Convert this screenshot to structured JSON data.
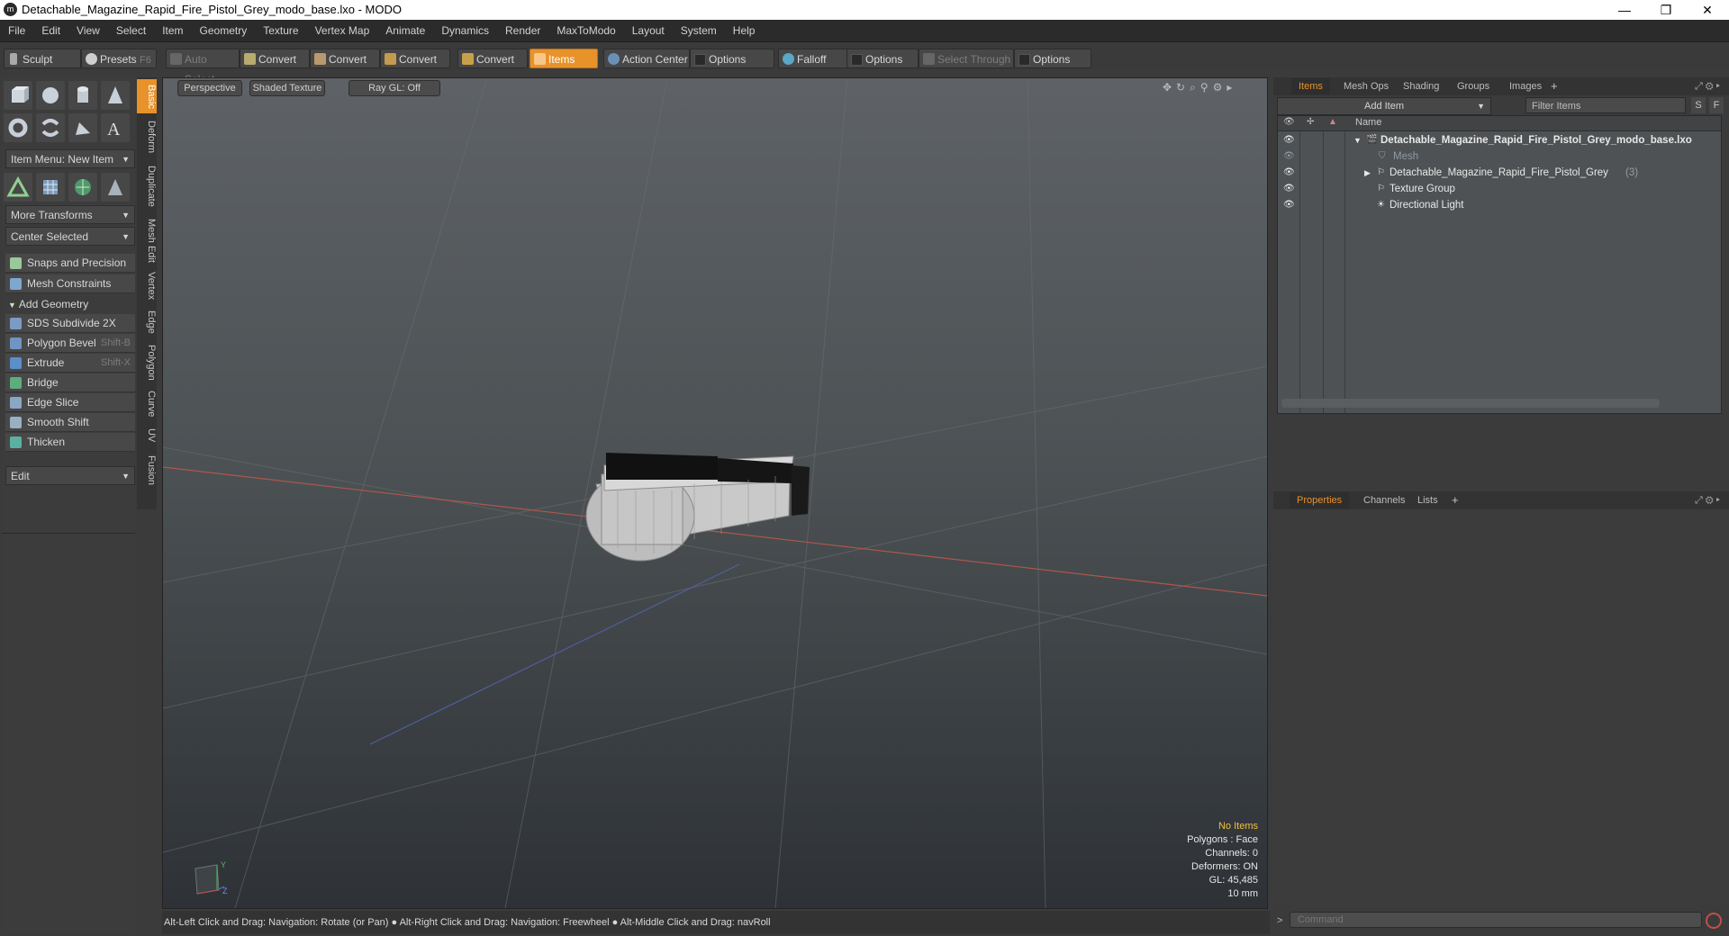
{
  "window": {
    "title": "Detachable_Magazine_Rapid_Fire_Pistol_Grey_modo_base.lxo - MODO",
    "logo": "modo-logo-icon"
  },
  "menu": [
    "File",
    "Edit",
    "View",
    "Select",
    "Item",
    "Geometry",
    "Texture",
    "Vertex Map",
    "Animate",
    "Dynamics",
    "Render",
    "MaxToModo",
    "Layout",
    "System",
    "Help"
  ],
  "toolbar": {
    "sculpt": "Sculpt",
    "presets": "Presets",
    "presets_key": "F6",
    "auto_select": "Auto Select",
    "convert": "Convert",
    "items": "Items",
    "action_center": "Action Center",
    "options": "Options",
    "falloff": "Falloff",
    "select_through": "Select Through"
  },
  "left": {
    "item_menu": "Item Menu: New Item",
    "more_transforms": "More Transforms",
    "center_selected": "Center Selected",
    "snaps": "Snaps and Precision",
    "mesh_constraints": "Mesh Constraints",
    "add_geometry": "Add Geometry",
    "tools": [
      {
        "label": "SDS Subdivide 2X",
        "key": ""
      },
      {
        "label": "Polygon Bevel",
        "key": "Shift-B"
      },
      {
        "label": "Extrude",
        "key": "Shift-X"
      },
      {
        "label": "Bridge",
        "key": ""
      },
      {
        "label": "Edge Slice",
        "key": ""
      },
      {
        "label": "Smooth Shift",
        "key": ""
      },
      {
        "label": "Thicken",
        "key": ""
      }
    ],
    "edit": "Edit",
    "vtabs": [
      "Basic",
      "Deform",
      "Duplicate",
      "Mesh Edit",
      "Vertex",
      "Edge",
      "Polygon",
      "Curve",
      "UV",
      "Fusion"
    ]
  },
  "viewport": {
    "view": "Perspective",
    "shading": "Shaded Texture",
    "raygl": "Ray GL: Off",
    "hud": {
      "selection": "No Items",
      "polygons": "Polygons : Face",
      "channels": "Channels: 0",
      "deformers": "Deformers: ON",
      "gl": "GL: 45,485",
      "scale": "10 mm"
    },
    "axis_y": "Y",
    "axis_z": "Z"
  },
  "status": "Alt-Left Click and Drag: Navigation: Rotate (or Pan) ● Alt-Right Click and Drag: Navigation: Freewheel ● Alt-Middle Click and Drag: navRoll",
  "items_panel": {
    "tabs": [
      "Items",
      "Mesh Ops",
      "Shading",
      "Groups",
      "Images"
    ],
    "add_item": "Add Item",
    "filter": "Filter Items",
    "btn_s": "S",
    "btn_f": "F",
    "col_name": "Name",
    "tree": [
      {
        "label": "Detachable_Magazine_Rapid_Fire_Pistol_Grey_modo_base.lxo",
        "count": ""
      },
      {
        "label": "Mesh",
        "count": ""
      },
      {
        "label": "Detachable_Magazine_Rapid_Fire_Pistol_Grey",
        "count": "(3)"
      },
      {
        "label": "Texture Group",
        "count": ""
      },
      {
        "label": "Directional Light",
        "count": ""
      }
    ]
  },
  "props_panel": {
    "tabs": [
      "Properties",
      "Channels",
      "Lists"
    ]
  },
  "command": {
    "placeholder": "Command",
    "prompt": ">"
  },
  "colors": {
    "accent": "#e8922a"
  }
}
